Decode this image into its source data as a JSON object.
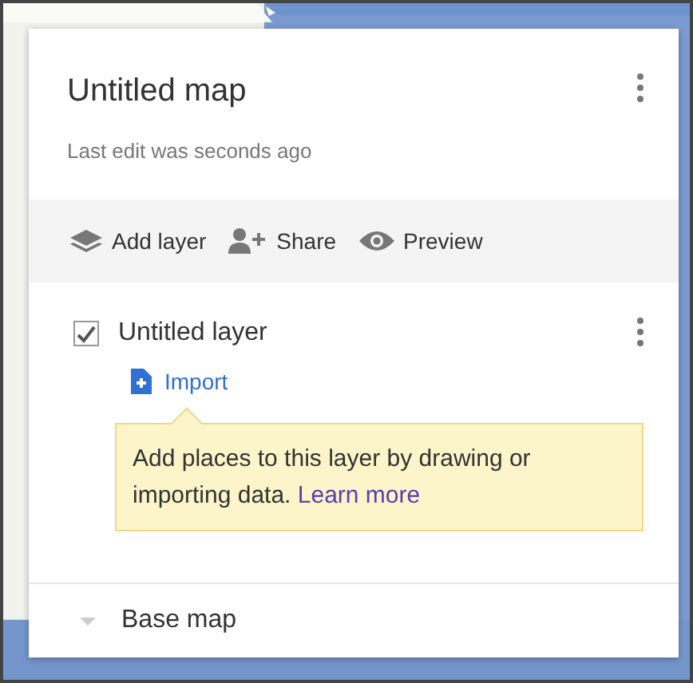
{
  "map": {
    "title": "Untitled map",
    "subtitle": "Last edit was seconds ago"
  },
  "toolbar": [
    {
      "kind": "add-layer",
      "label": "Add layer"
    },
    {
      "kind": "share",
      "label": "Share"
    },
    {
      "kind": "preview",
      "label": "Preview"
    }
  ],
  "layer": {
    "name": "Untitled layer",
    "checked": true,
    "import_label": "Import"
  },
  "hint": {
    "text": "Add places to this layer by drawing or importing data.",
    "link": "Learn more"
  },
  "base_map": {
    "label": "Base map"
  }
}
